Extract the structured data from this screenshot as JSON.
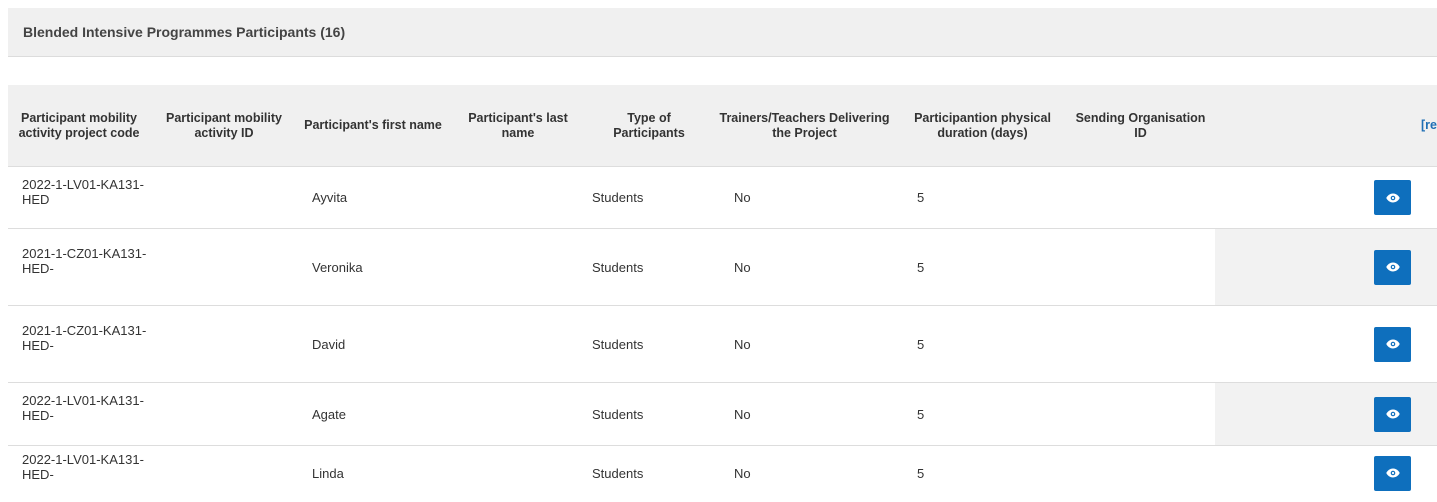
{
  "panel": {
    "title": "Blended Intensive Programmes Participants (16)"
  },
  "table": {
    "columns": [
      "Participant mobility activity project code",
      "Participant mobility activity ID",
      "Participant's first name",
      "Participant's last name",
      "Type of Participants",
      "Trainers/Teachers Delivering the Project",
      "Participantion physical duration (days)",
      "Sending Organisation ID",
      "[re"
    ],
    "rows": [
      {
        "project_code": "2022-1-LV01-KA131-HED",
        "activity_id": "",
        "first_name": "Ayvita",
        "last_name": "",
        "type": "Students",
        "trainers": "No",
        "duration": "5",
        "sending_org_id": ""
      },
      {
        "project_code": "2021-1-CZ01-KA131-HED-",
        "activity_id": "",
        "first_name": "Veronika",
        "last_name": "",
        "type": "Students",
        "trainers": "No",
        "duration": "5",
        "sending_org_id": ""
      },
      {
        "project_code": "2021-1-CZ01-KA131-HED-",
        "activity_id": "",
        "first_name": "David",
        "last_name": "",
        "type": "Students",
        "trainers": "No",
        "duration": "5",
        "sending_org_id": ""
      },
      {
        "project_code": "2022-1-LV01-KA131-HED-",
        "activity_id": "",
        "first_name": "Agate",
        "last_name": "",
        "type": "Students",
        "trainers": "No",
        "duration": "5",
        "sending_org_id": ""
      },
      {
        "project_code": "2022-1-LV01-KA131-HED-",
        "activity_id": "",
        "first_name": "Linda",
        "last_name": "",
        "type": "Students",
        "trainers": "No",
        "duration": "5",
        "sending_org_id": ""
      }
    ],
    "action_icon": "eye-icon"
  },
  "colors": {
    "header_bg": "#f0f0f0",
    "button_bg": "#0e6fbd",
    "link": "#1f6fb5"
  }
}
